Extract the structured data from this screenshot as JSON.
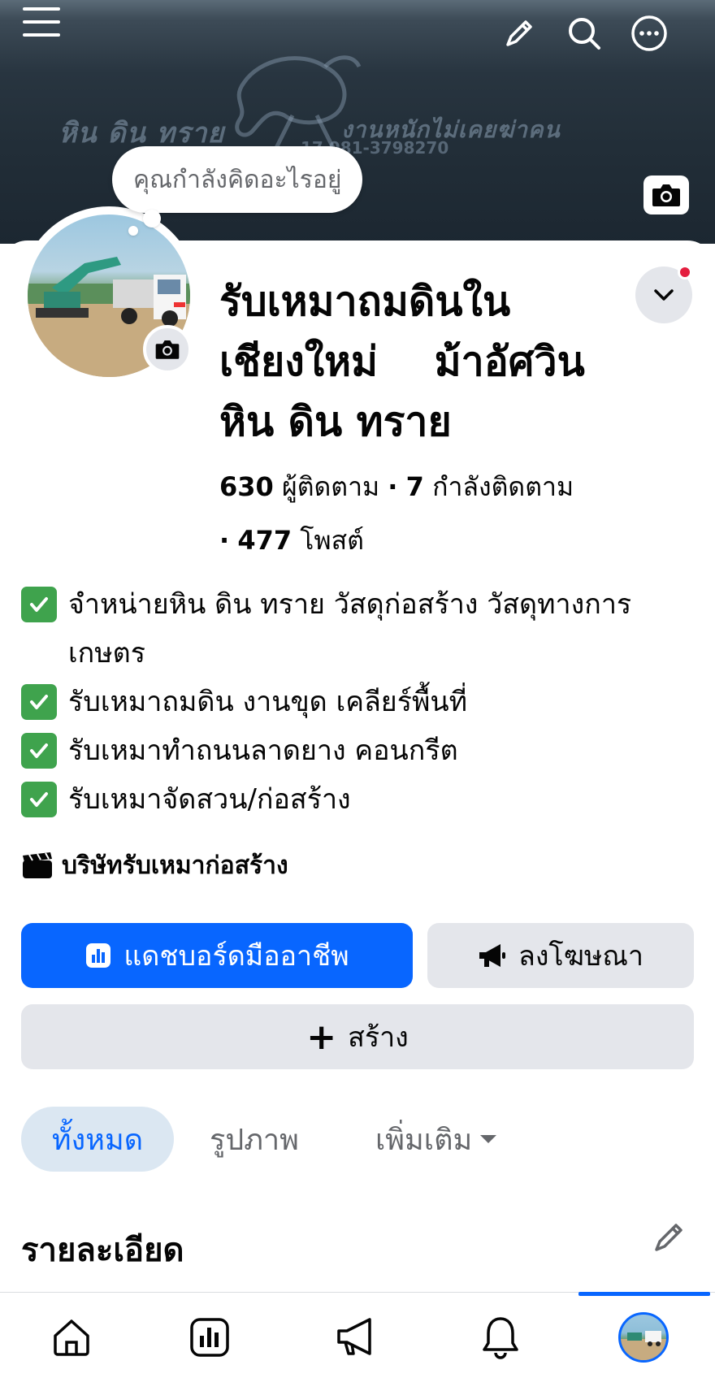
{
  "cover": {
    "slogan_left": "หิน ดิน ทราย",
    "slogan_right": "งานหนักไม่เคยฆ่าคน",
    "phone": "17 081-3798270"
  },
  "thought_prompt": "คุณกำลังคิดอะไรอยู่",
  "page": {
    "name_lines": [
      "รับเหมาถมดินใน",
      "เชียงใหม่    ม้าอัศวิน",
      "หิน ดิน ทราย"
    ],
    "followers_count": "630",
    "followers_label": "ผู้ติดตาม",
    "following_count": "7",
    "following_label": "กำลังติดตาม",
    "posts_count": "477",
    "posts_label": "โพสต์",
    "separator": "·"
  },
  "bio": [
    "จำหน่ายหิน ดิน ทราย วัสดุก่อสร้าง วัสดุทางการเกษตร",
    "รับเหมาถมดิน งานขุด เคลียร์พื้นที่",
    "รับเหมาทำถนนลาดยาง คอนกรีต",
    "รับเหมาจัดสวน/ก่อสร้าง"
  ],
  "category": "บริษัทรับเหมาก่อสร้าง",
  "buttons": {
    "dashboard": "แดชบอร์ดมืออาชีพ",
    "advertise": "ลงโฆษณา",
    "create": "สร้าง",
    "create_plus": "+"
  },
  "tabs": {
    "all": "ทั้งหมด",
    "photos": "รูปภาพ",
    "more": "เพิ่มเติม"
  },
  "section": {
    "details_title": "รายละเอียด"
  },
  "colors": {
    "primary": "#0866ff",
    "secondary_bg": "#e4e6eb",
    "notification": "#e41e3f",
    "check": "#3fa34d"
  },
  "icons": {
    "top": [
      "menu-icon",
      "pencil-icon",
      "search-icon",
      "more-icon"
    ],
    "bottom_nav": [
      "home-icon",
      "dashboard-icon",
      "megaphone-icon",
      "bell-icon",
      "profile-avatar"
    ]
  }
}
